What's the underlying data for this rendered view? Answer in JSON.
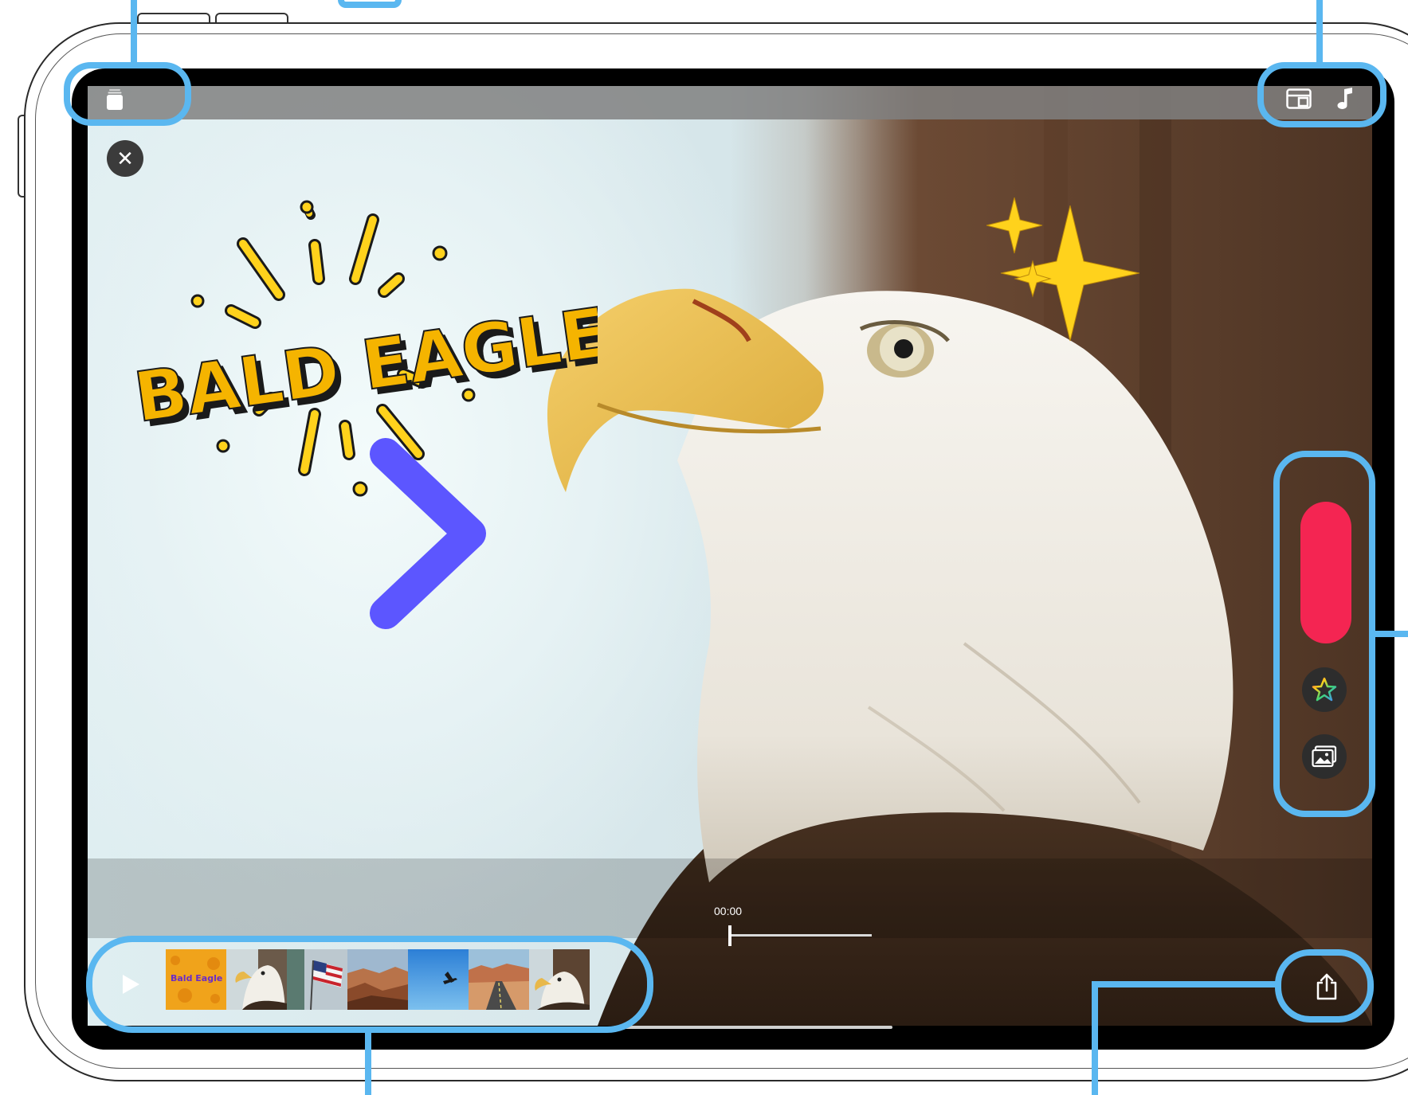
{
  "device": {
    "model": "iPad"
  },
  "top_bar": {
    "left_icon": "library-icon",
    "right_icons": [
      "layout-icon",
      "music-icon"
    ]
  },
  "close_button": {
    "glyph": "✕",
    "icon": "close-icon"
  },
  "sticker": {
    "title_text": "BALD EAGLE",
    "title_color": "#f5b400"
  },
  "side_panel": {
    "record_color": "#f42552",
    "effects_icon": "star-effects-icon",
    "photos_icon": "photo-library-icon"
  },
  "timeline": {
    "timecode": "00:00",
    "progress": 0.0,
    "clips": [
      {
        "name": "title-card",
        "label": "Bald Eagle"
      },
      {
        "name": "eagle-portrait"
      },
      {
        "name": "flag"
      },
      {
        "name": "canyon"
      },
      {
        "name": "sky-bird"
      },
      {
        "name": "desert-road"
      },
      {
        "name": "eagle-closeup"
      }
    ]
  },
  "share_button": {
    "icon": "share-icon"
  },
  "play_button": {
    "icon": "play-icon"
  },
  "colors": {
    "callout": "#5ab7f0",
    "record": "#f42552",
    "arrow_start": "#ff00d8",
    "arrow_end": "#4a5bff"
  }
}
